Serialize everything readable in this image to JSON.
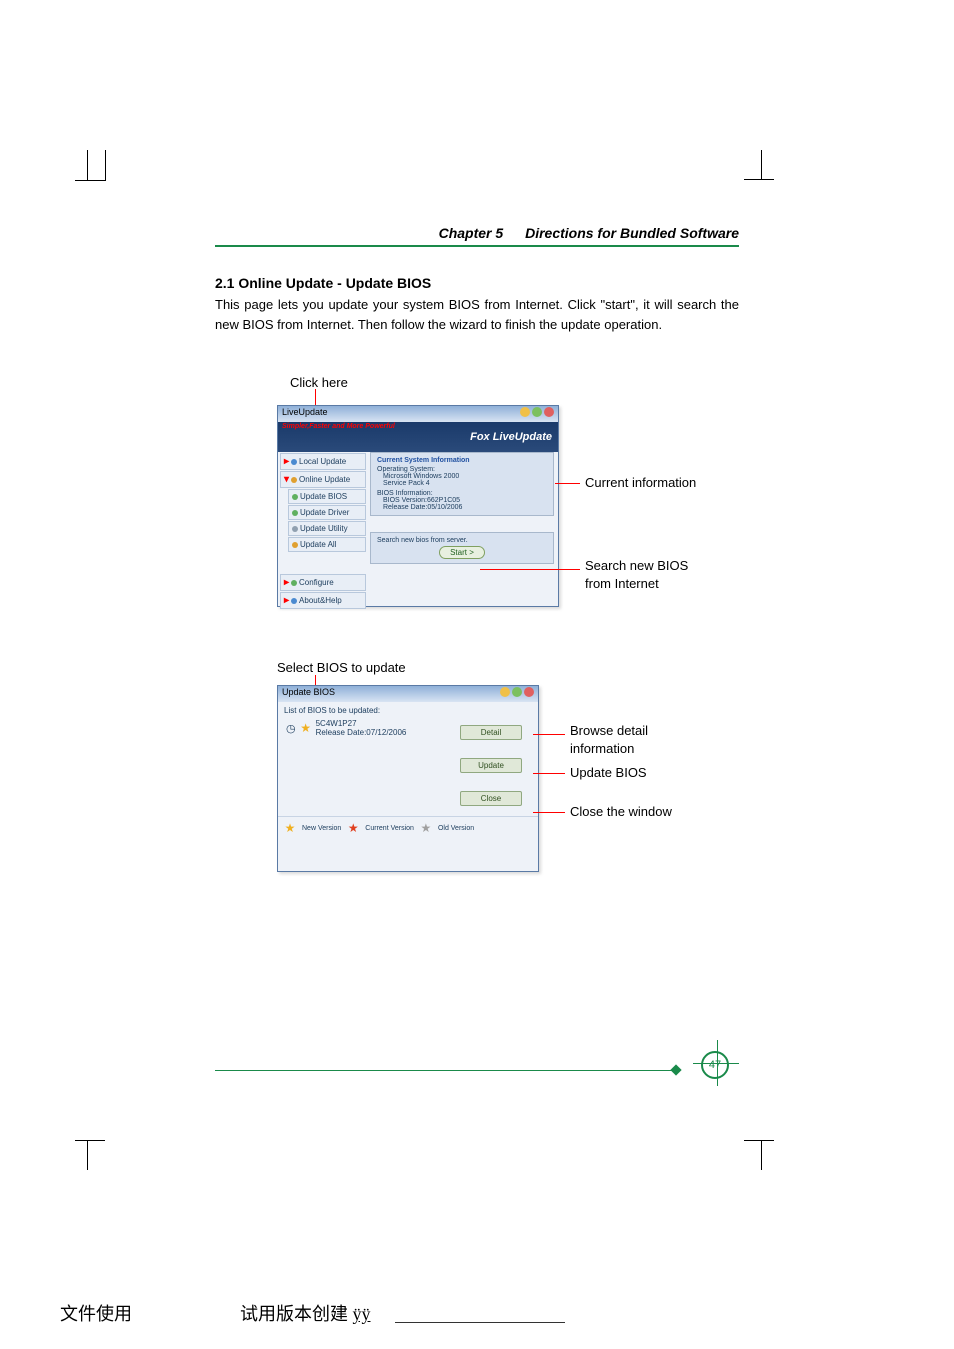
{
  "header": {
    "chapter": "Chapter 5",
    "title": "Directions for Bundled Software"
  },
  "section": {
    "heading": "2.1 Online Update - Update BIOS",
    "body": "This page lets you update your system BIOS from Internet. Click \"start\", it will search the new BIOS from Internet. Then follow the wizard to finish the update operation."
  },
  "fig1": {
    "caption": "Click here",
    "window_title": "LiveUpdate",
    "banner_slogan": "Simpler,Faster and More Powerful",
    "banner_brand": "Fox LiveUpdate",
    "nav": {
      "local_update": "Local Update",
      "online_update": "Online Update",
      "update_bios": "Update BIOS",
      "update_driver": "Update Driver",
      "update_utility": "Update Utility",
      "update_all": "Update All",
      "configure": "Configure",
      "about_help": "About&Help"
    },
    "panel1": {
      "title": "Current System Information",
      "os_label": "Operating System:",
      "os_line1": "Microsoft Windows 2000",
      "os_line2": "Service Pack 4",
      "bios_label": "BIOS Information:",
      "bios_line1": "BIOS Version:662P1C05",
      "bios_line2": "Release Date:05/10/2006"
    },
    "panel2": {
      "text": "Search new bios from server.",
      "button": "Start  >"
    },
    "ann_right1": "Current information",
    "ann_right2a": "Search new BIOS",
    "ann_right2b": "from Internet"
  },
  "fig2": {
    "caption": "Select BIOS to update",
    "window_title": "Update BIOS",
    "list_label": "List of BIOS to be updated:",
    "entry_name": "5C4W1P27",
    "entry_date": "Release Date:07/12/2006",
    "btn_detail": "Detail",
    "btn_update": "Update",
    "btn_close": "Close",
    "legend_new": "New Version",
    "legend_cur": "Current Version",
    "legend_old": "Old Version",
    "ann_detail_a": "Browse detail",
    "ann_detail_b": "information",
    "ann_update": "Update BIOS",
    "ann_close": "Close the window"
  },
  "page_number": "47",
  "footer": {
    "left": "文件使用",
    "mid": "试用版本创建",
    "link": "ÿÿ"
  }
}
